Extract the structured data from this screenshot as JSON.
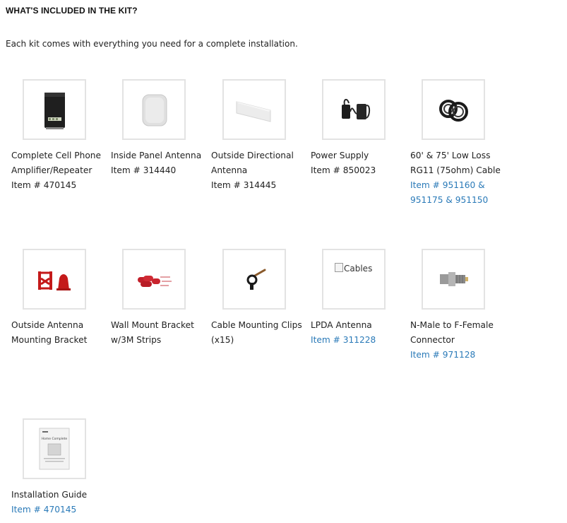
{
  "heading": "WHAT'S INCLUDED IN THE KIT?",
  "intro": "Each kit comes with everything you need for a complete installation.",
  "colors": {
    "link": "#2a7ab8",
    "text": "#222222",
    "thumb_border": "#e3e3e3"
  },
  "items": [
    {
      "label": "Complete Cell Phone Amplifier/Repeater",
      "code": "Item # 470145",
      "code_is_link": false,
      "icon": "amplifier-icon"
    },
    {
      "label": "Inside Panel Antenna",
      "code": "Item # 314440",
      "code_is_link": false,
      "icon": "panel-antenna-icon"
    },
    {
      "label": "Outside Directional Antenna",
      "code": "Item # 314445",
      "code_is_link": false,
      "icon": "directional-antenna-icon"
    },
    {
      "label": "Power Supply",
      "code": "Item # 850023",
      "code_is_link": false,
      "icon": "power-supply-icon"
    },
    {
      "label": "60' & 75' Low Loss RG11 (75ohm) Cable",
      "code": "Item # 951160 & 951175 & 951150",
      "code_is_link": true,
      "icon": "cable-coil-icon"
    },
    {
      "label": "Outside Antenna Mounting Bracket",
      "code": "",
      "code_is_link": false,
      "icon": "mounting-bracket-icon"
    },
    {
      "label": "Wall Mount Bracket w/3M Strips",
      "code": "",
      "code_is_link": false,
      "icon": "adhesive-strips-icon"
    },
    {
      "label": "Cable Mounting Clips (x15)",
      "code": "",
      "code_is_link": false,
      "icon": "cable-clip-icon"
    },
    {
      "label": "LPDA Antenna",
      "code": "Item # 311228",
      "code_is_link": true,
      "icon": "broken-image-icon",
      "broken_alt": "Cables"
    },
    {
      "label": "N-Male to F-Female Connector",
      "code": "Item # 971128",
      "code_is_link": true,
      "icon": "connector-icon"
    },
    {
      "label": "Installation Guide",
      "code": "Item # 470145",
      "code_is_link": true,
      "icon": "guide-booklet-icon",
      "guide_title": "Home Complete"
    }
  ]
}
